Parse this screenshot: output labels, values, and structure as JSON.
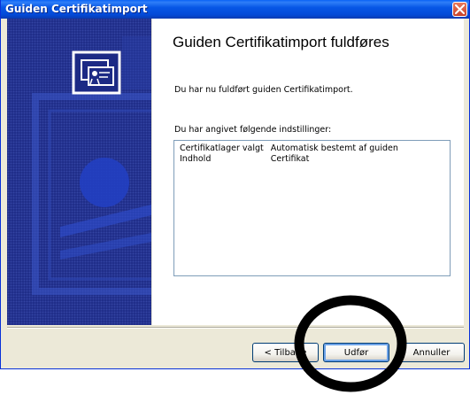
{
  "window": {
    "title": "Guiden Certifikatimport",
    "close_icon": "close-icon"
  },
  "side_panel": {
    "icon": "certificate-icon"
  },
  "content": {
    "heading": "Guiden Certifikatimport fuldføres",
    "intro": "Du har nu fuldført guiden Certifikatimport.",
    "settings_label": "Du har angivet følgende indstillinger:",
    "settings": [
      {
        "key": "Certifikatlager valgt",
        "value": "Automatisk bestemt af guiden"
      },
      {
        "key": "Indhold",
        "value": "Certifikat"
      }
    ]
  },
  "buttons": {
    "back": "< Tilbage",
    "finish": "Udfør",
    "cancel": "Annuller"
  },
  "colors": {
    "titlebar": "#0a5ae6",
    "side_panel": "#1c2a85",
    "annotation": "#000000"
  }
}
